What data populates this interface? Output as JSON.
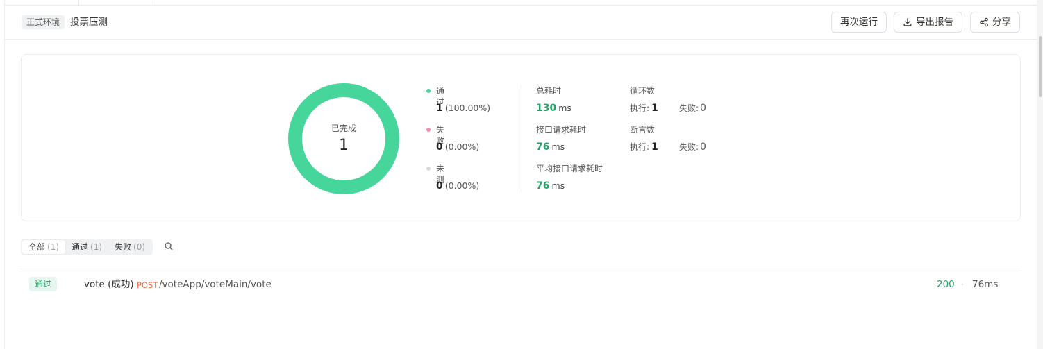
{
  "header": {
    "env_tag": "正式环境",
    "title": "投票压测",
    "buttons": {
      "rerun": "再次运行",
      "export": "导出报告",
      "share": "分享"
    }
  },
  "summary": {
    "donut_label": "已完成",
    "donut_value": "1",
    "donut_pass_fraction": 1.0,
    "colors": {
      "pass": "#46d69b",
      "fail": "#f08fa8",
      "untested": "#d9d9d9",
      "accent_green": "#27a067"
    },
    "legend": [
      {
        "name": "通过",
        "count": "1",
        "percent": "(100.00%)"
      },
      {
        "name": "失败",
        "count": "0",
        "percent": "(0.00%)"
      },
      {
        "name": "未测",
        "count": "0",
        "percent": "(0.00%)"
      }
    ],
    "total_time": {
      "label": "总耗时",
      "value": "130",
      "unit": "ms"
    },
    "api_time": {
      "label": "接口请求耗时",
      "value": "76",
      "unit": "ms"
    },
    "avg_api_time": {
      "label": "平均接口请求耗时",
      "value": "76",
      "unit": "ms"
    },
    "loops": {
      "label": "循环数",
      "exec_label": "执行:",
      "exec_value": "1",
      "fail_label": "失败:",
      "fail_value": "0"
    },
    "assertions": {
      "label": "断言数",
      "exec_label": "执行:",
      "exec_value": "1",
      "fail_label": "失败:",
      "fail_value": "0"
    }
  },
  "filters": [
    {
      "label": "全部",
      "count": "(1)"
    },
    {
      "label": "通过",
      "count": "(1)"
    },
    {
      "label": "失败",
      "count": "(0)"
    }
  ],
  "results": [
    {
      "status": "通过",
      "name": "vote (成功)",
      "method": "POST",
      "path": "/voteApp/voteMain/vote",
      "code": "200",
      "separator": "·",
      "time": "76ms"
    }
  ]
}
